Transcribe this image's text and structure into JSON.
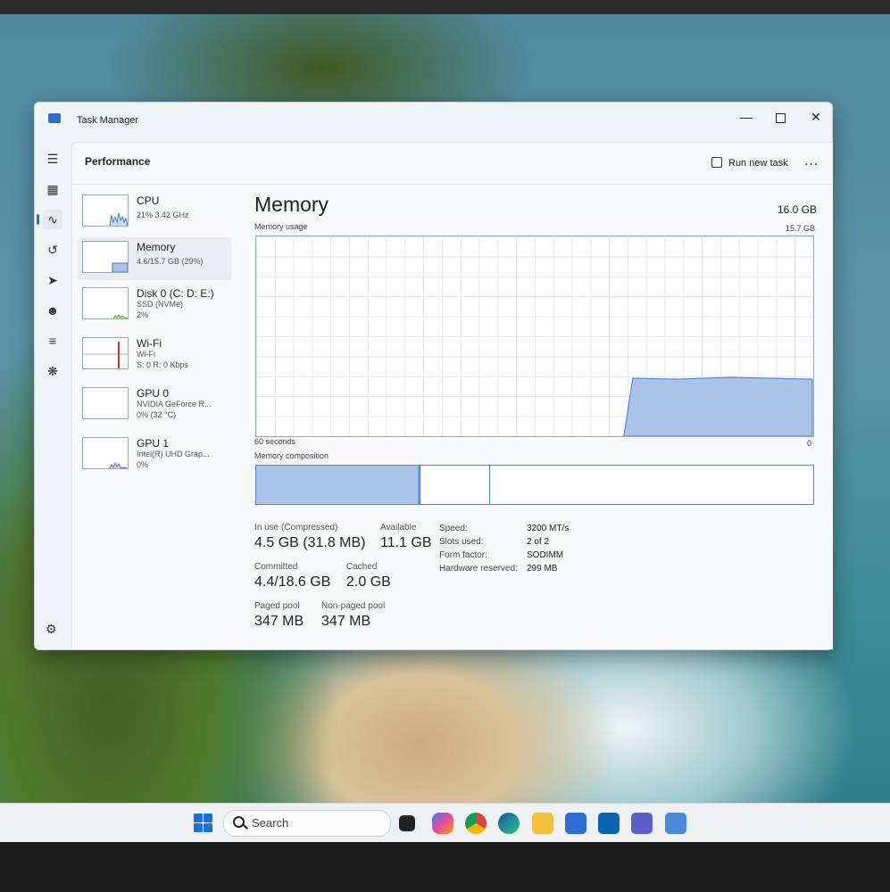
{
  "window": {
    "title": "Task Manager"
  },
  "header": {
    "page_title": "Performance",
    "run_new_task": "Run new task",
    "more": "..."
  },
  "resources": [
    {
      "name": "CPU",
      "line1": "21%  3.42 GHz",
      "line2": ""
    },
    {
      "name": "Memory",
      "line1": "4.6/15.7 GB (29%)",
      "line2": ""
    },
    {
      "name": "Disk 0 (C: D: E:)",
      "line1": "SSD (NVMe)",
      "line2": "2%"
    },
    {
      "name": "Wi-Fi",
      "line1": "Wi-Fi",
      "line2": "S: 0 R: 0 Kbps"
    },
    {
      "name": "GPU 0",
      "line1": "NVIDIA GeForce R...",
      "line2": "0%  (32 °C)"
    },
    {
      "name": "GPU 1",
      "line1": "Intel(R) UHD Grap...",
      "line2": "0%"
    }
  ],
  "memory": {
    "title": "Memory",
    "total": "16.0 GB",
    "usage_label": "Memory usage",
    "usage_max": "15.7 GB",
    "time_label": "60 seconds",
    "zero": "0",
    "composition_label": "Memory composition",
    "composition": {
      "in_use_fraction": 0.29,
      "modified_fraction": 0.003,
      "standby_fraction": 0.125
    },
    "usage_level_fraction": 0.29,
    "stats": {
      "in_use_label": "In use (Compressed)",
      "in_use_value": "4.5 GB (31.8 MB)",
      "available_label": "Available",
      "available_value": "11.1 GB",
      "committed_label": "Committed",
      "committed_value": "4.4/18.6 GB",
      "cached_label": "Cached",
      "cached_value": "2.0 GB",
      "paged_label": "Paged pool",
      "paged_value": "347 MB",
      "nonpaged_label": "Non-paged pool",
      "nonpaged_value": "347 MB"
    },
    "specs": {
      "speed_label": "Speed:",
      "speed_value": "3200 MT/s",
      "slots_label": "Slots used:",
      "slots_value": "2 of 2",
      "form_label": "Form factor:",
      "form_value": "SODIMM",
      "reserved_label": "Hardware reserved:",
      "reserved_value": "299 MB"
    }
  },
  "taskbar": {
    "search_label": "Search"
  },
  "colors": {
    "accent": "#1f6fd8",
    "graph_fill": "#aac4e8",
    "graph_line": "#4b78c4"
  }
}
